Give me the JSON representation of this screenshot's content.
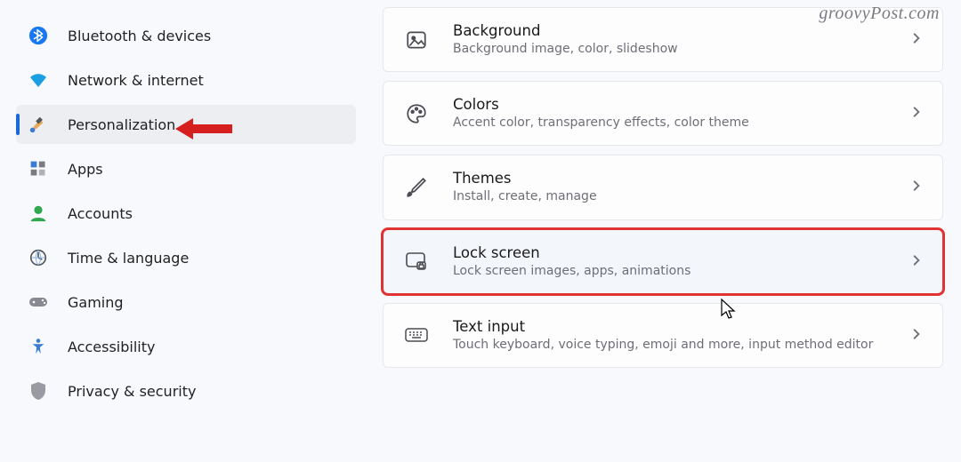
{
  "watermark": "groovyPost.com",
  "sidebar": {
    "items": [
      {
        "label": "Bluetooth & devices"
      },
      {
        "label": "Network & internet"
      },
      {
        "label": "Personalization"
      },
      {
        "label": "Apps"
      },
      {
        "label": "Accounts"
      },
      {
        "label": "Time & language"
      },
      {
        "label": "Gaming"
      },
      {
        "label": "Accessibility"
      },
      {
        "label": "Privacy & security"
      }
    ]
  },
  "main": {
    "cards": [
      {
        "title": "Background",
        "sub": "Background image, color, slideshow"
      },
      {
        "title": "Colors",
        "sub": "Accent color, transparency effects, color theme"
      },
      {
        "title": "Themes",
        "sub": "Install, create, manage"
      },
      {
        "title": "Lock screen",
        "sub": "Lock screen images, apps, animations"
      },
      {
        "title": "Text input",
        "sub": "Touch keyboard, voice typing, emoji and more, input method editor"
      }
    ]
  }
}
